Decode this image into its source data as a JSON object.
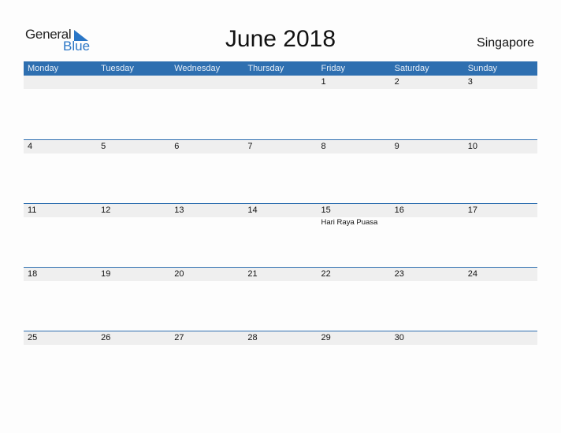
{
  "logo": {
    "word1": "General",
    "word2": "Blue"
  },
  "title": "June 2018",
  "country": "Singapore",
  "colors": {
    "header_bg": "#2e6fb0",
    "brand_blue": "#2a76c6",
    "strip_bg": "#efefef"
  },
  "weekdays": [
    "Monday",
    "Tuesday",
    "Wednesday",
    "Thursday",
    "Friday",
    "Saturday",
    "Sunday"
  ],
  "weeks": [
    {
      "days": [
        "",
        "",
        "",
        "",
        "1",
        "2",
        "3"
      ],
      "events": [
        "",
        "",
        "",
        "",
        "",
        "",
        ""
      ]
    },
    {
      "days": [
        "4",
        "5",
        "6",
        "7",
        "8",
        "9",
        "10"
      ],
      "events": [
        "",
        "",
        "",
        "",
        "",
        "",
        ""
      ]
    },
    {
      "days": [
        "11",
        "12",
        "13",
        "14",
        "15",
        "16",
        "17"
      ],
      "events": [
        "",
        "",
        "",
        "",
        "Hari Raya Puasa",
        "",
        ""
      ]
    },
    {
      "days": [
        "18",
        "19",
        "20",
        "21",
        "22",
        "23",
        "24"
      ],
      "events": [
        "",
        "",
        "",
        "",
        "",
        "",
        ""
      ]
    },
    {
      "days": [
        "25",
        "26",
        "27",
        "28",
        "29",
        "30",
        ""
      ],
      "events": [
        "",
        "",
        "",
        "",
        "",
        "",
        ""
      ]
    }
  ]
}
